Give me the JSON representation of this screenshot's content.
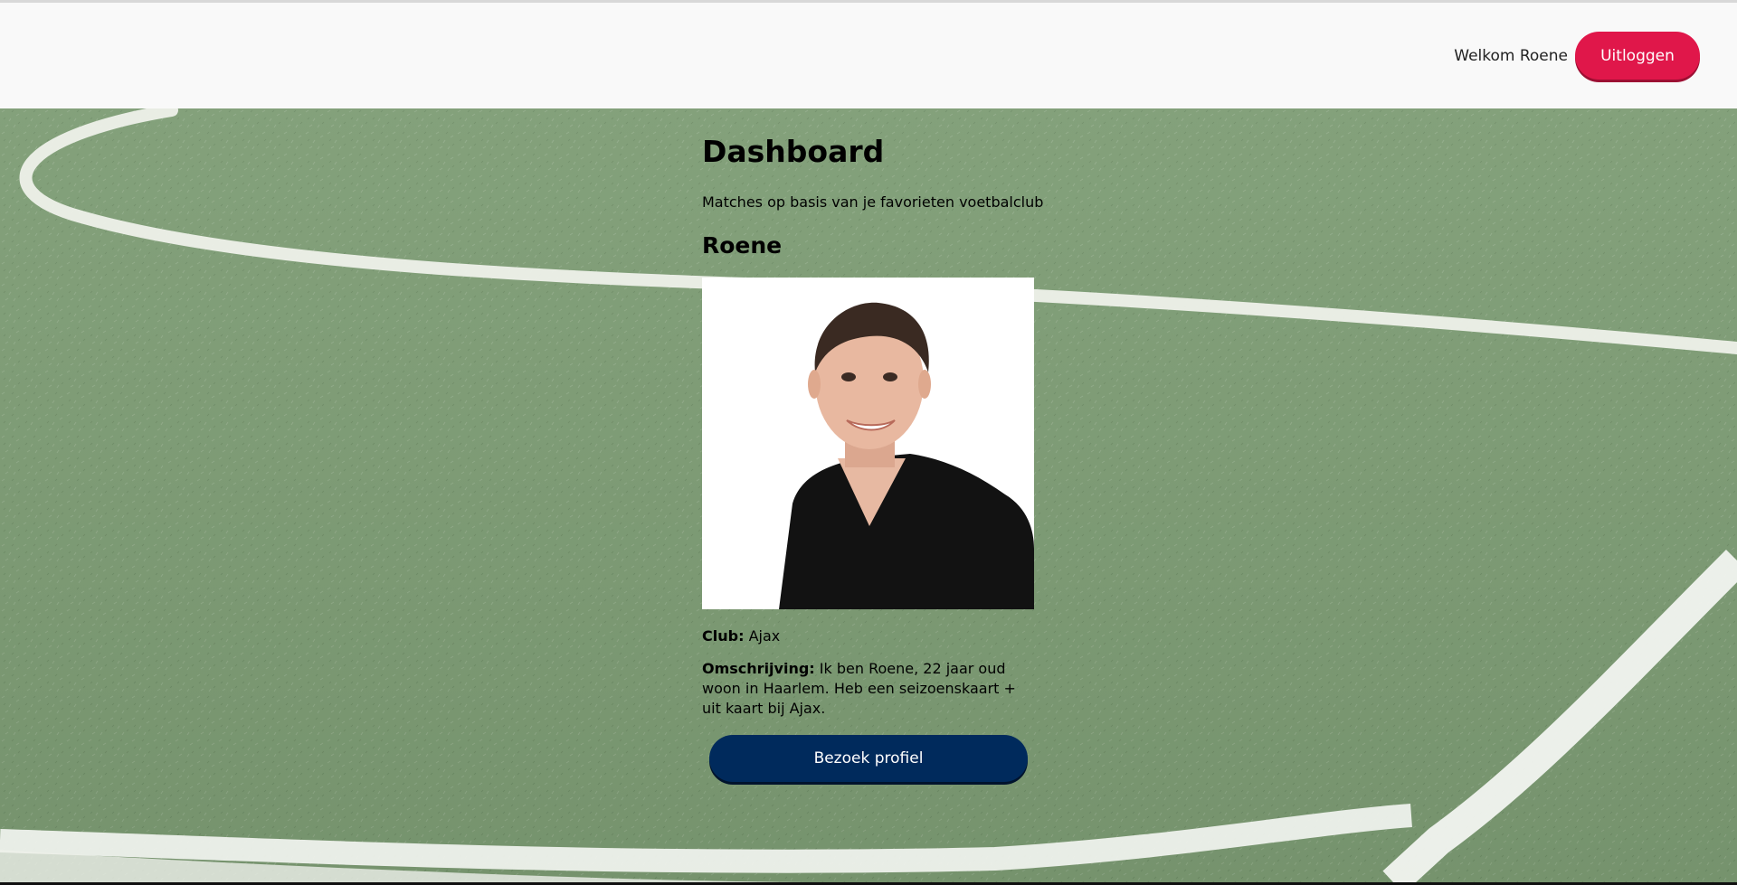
{
  "header": {
    "welcome_text": "Welkom Roene",
    "logout_label": "Uitloggen"
  },
  "main": {
    "title": "Dashboard",
    "subtitle": "Matches op basis van je favorieten voetbalclub",
    "match": {
      "name": "Roene",
      "club_label": "Club:",
      "club_value": "Ajax",
      "description_label": "Omschrijving:",
      "description_value": "Ik ben Roene, 22 jaar oud woon in Haarlem. Heb een seizoenskaart + uit kaart bij Ajax.",
      "visit_label": "Bezoek profiel"
    }
  },
  "colors": {
    "logout_button": "#e0174a",
    "visit_button": "#002a5c",
    "field_grass": "#7d9c74"
  }
}
